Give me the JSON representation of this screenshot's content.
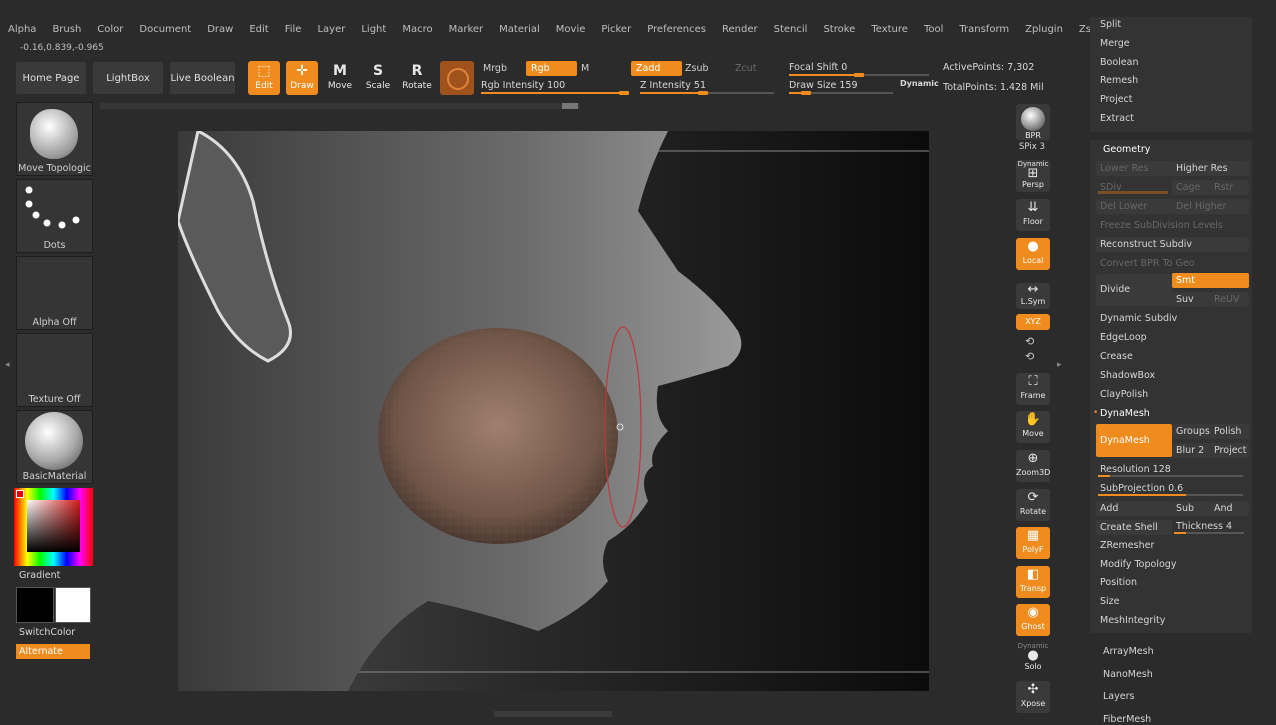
{
  "menu": [
    "Alpha",
    "Brush",
    "Color",
    "Document",
    "Draw",
    "Edit",
    "File",
    "Layer",
    "Light",
    "Macro",
    "Marker",
    "Material",
    "Movie",
    "Picker",
    "Preferences",
    "Render",
    "Stencil",
    "Stroke",
    "Texture",
    "Tool",
    "Transform",
    "Zplugin",
    "Zscript"
  ],
  "coords": "-0.16,0.839,-0.965",
  "shelf": {
    "home": "Home Page",
    "lightbox": "LightBox",
    "live_boolean": "Live Boolean",
    "edit": "Edit",
    "draw": "Draw",
    "move": "Move",
    "scale": "Scale",
    "rotate": "Rotate",
    "move_key": "M",
    "scale_key": "S",
    "rotate_key": "R"
  },
  "paint": {
    "mrgb": "Mrgb",
    "rgb": "Rgb",
    "m": "M",
    "rgb_intensity_label": "Rgb Intensity",
    "rgb_intensity": "100",
    "zadd": "Zadd",
    "zsub": "Zsub",
    "zcut": "Zcut",
    "z_intensity_label": "Z Intensity",
    "z_intensity": "51",
    "rgb_intensity_level": 1.0,
    "z_intensity_level": 0.51
  },
  "brush": {
    "focal_label": "Focal Shift",
    "focal": "0",
    "size_label": "Draw Size",
    "size": "159",
    "dynamic": "Dynamic"
  },
  "stats": {
    "active": "ActivePoints: 7,302",
    "total": "TotalPoints: 1.428 Mil"
  },
  "left": {
    "tool_name": "Move Topologic",
    "stroke_name": "Dots",
    "alpha": "Alpha Off",
    "texture": "Texture Off",
    "material": "BasicMaterial",
    "gradient": "Gradient",
    "switch_color": "SwitchColor",
    "alternate": "Alternate",
    "main_color": "#000000",
    "secondary_color": "#ffffff"
  },
  "right_tools": {
    "bpr": "BPR",
    "spix_label": "SPix",
    "spix": "3",
    "dynamic": "Dynamic",
    "persp": "Persp",
    "floor": "Floor",
    "local": "Local",
    "lsym": "L.Sym",
    "xyz": "XYZ",
    "frame": "Frame",
    "move": "Move",
    "zoom": "Zoom3D",
    "rotate": "Rotate",
    "polyf": "PolyF",
    "transp": "Transp",
    "ghost": "Ghost",
    "solo_dyn": "Dynamic",
    "solo": "Solo",
    "xpose": "Xpose"
  },
  "geometry_top": [
    "Split",
    "Merge",
    "Boolean",
    "Remesh",
    "Project",
    "Extract"
  ],
  "geometry": {
    "title": "Geometry",
    "lower_res": "Lower Res",
    "higher_res": "Higher Res",
    "sdiv": "SDiv",
    "cage": "Cage",
    "rstr": "Rstr",
    "del_lower": "Del Lower",
    "del_higher": "Del Higher",
    "freeze": "Freeze SubDivision Levels",
    "reconstruct": "Reconstruct Subdiv",
    "convert_bpr": "Convert BPR To Geo",
    "divide": "Divide",
    "smt": "Smt",
    "suv": "Suv",
    "reuv": "ReUV",
    "dynamic_subdiv": "Dynamic Subdiv",
    "edgeloop": "EdgeLoop",
    "crease": "Crease",
    "shadowbox": "ShadowBox",
    "claypolish": "ClayPolish",
    "dynamesh_title": "DynaMesh",
    "dynamesh_btn": "DynaMesh",
    "groups": "Groups",
    "polish": "Polish",
    "blur": "Blur",
    "blur_val": "2",
    "project": "Project",
    "resolution_label": "Resolution",
    "resolution": "128",
    "subprojection_label": "SubProjection",
    "subprojection": "0.6",
    "add": "Add",
    "sub": "Sub",
    "and": "And",
    "create_shell": "Create Shell",
    "thickness_label": "Thickness",
    "thickness": "4",
    "zremesher": "ZRemesher",
    "modify_topology": "Modify Topology",
    "position": "Position",
    "size": "Size",
    "meshintegrity": "MeshIntegrity"
  },
  "bottom_list": [
    "ArrayMesh",
    "NanoMesh",
    "Layers",
    "FiberMesh"
  ],
  "colors": {
    "accent": "#f08c1e",
    "panel": "#333333",
    "bg": "#2b2b2b"
  }
}
